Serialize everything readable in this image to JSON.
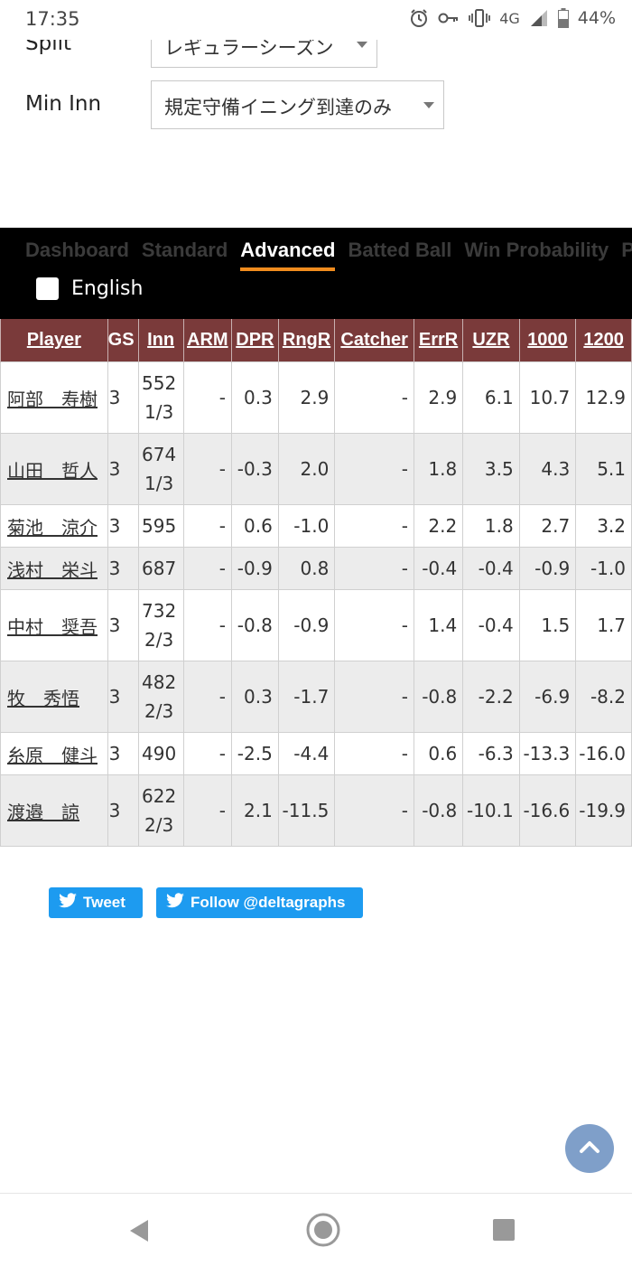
{
  "status_bar": {
    "time": "17:35",
    "network": "4G",
    "battery": "44%",
    "icons": [
      "alarm-icon",
      "key-icon",
      "vibrate-icon",
      "signal-icon",
      "battery-icon"
    ]
  },
  "filters": {
    "split_label": "Split",
    "split_value": "レギュラーシーズン",
    "min_inn_label": "Min Inn",
    "min_inn_value": "規定守備イニング到達のみ"
  },
  "tabs": [
    "Dashboard",
    "Standard",
    "Advanced",
    "Batted Ball",
    "Win Probability",
    "Pitch Type"
  ],
  "active_tab": "Advanced",
  "english_label": "English",
  "table": {
    "columns": [
      "Player",
      "GS",
      "Inn",
      "ARM",
      "DPR",
      "RngR",
      "Catcher",
      "ErrR",
      "UZR",
      "1000",
      "1200"
    ],
    "rows": [
      {
        "player": "阿部　寿樹",
        "gs": "3",
        "inn": "552\n1/3",
        "arm": "-",
        "dpr": "0.3",
        "rngr": "2.9",
        "catcher": "-",
        "errr": "2.9",
        "uzr": "6.1",
        "c1000": "10.7",
        "c1200": "12.9"
      },
      {
        "player": "山田　哲人",
        "gs": "3",
        "inn": "674\n1/3",
        "arm": "-",
        "dpr": "-0.3",
        "rngr": "2.0",
        "catcher": "-",
        "errr": "1.8",
        "uzr": "3.5",
        "c1000": "4.3",
        "c1200": "5.1"
      },
      {
        "player": "菊池　涼介",
        "gs": "3",
        "inn": "595",
        "arm": "-",
        "dpr": "0.6",
        "rngr": "-1.0",
        "catcher": "-",
        "errr": "2.2",
        "uzr": "1.8",
        "c1000": "2.7",
        "c1200": "3.2"
      },
      {
        "player": "浅村　栄斗",
        "gs": "3",
        "inn": "687",
        "arm": "-",
        "dpr": "-0.9",
        "rngr": "0.8",
        "catcher": "-",
        "errr": "-0.4",
        "uzr": "-0.4",
        "c1000": "-0.9",
        "c1200": "-1.0"
      },
      {
        "player": "中村　奨吾",
        "gs": "3",
        "inn": "732\n2/3",
        "arm": "-",
        "dpr": "-0.8",
        "rngr": "-0.9",
        "catcher": "-",
        "errr": "1.4",
        "uzr": "-0.4",
        "c1000": "1.5",
        "c1200": "1.7"
      },
      {
        "player": "牧　秀悟",
        "gs": "3",
        "inn": "482\n2/3",
        "arm": "-",
        "dpr": "0.3",
        "rngr": "-1.7",
        "catcher": "-",
        "errr": "-0.8",
        "uzr": "-2.2",
        "c1000": "-6.9",
        "c1200": "-8.2"
      },
      {
        "player": "糸原　健斗",
        "gs": "3",
        "inn": "490",
        "arm": "-",
        "dpr": "-2.5",
        "rngr": "-4.4",
        "catcher": "-",
        "errr": "0.6",
        "uzr": "-6.3",
        "c1000": "-13.3",
        "c1200": "-16.0"
      },
      {
        "player": "渡邉　諒",
        "gs": "3",
        "inn": "622\n2/3",
        "arm": "-",
        "dpr": "2.1",
        "rngr": "-11.5",
        "catcher": "-",
        "errr": "-0.8",
        "uzr": "-10.1",
        "c1000": "-16.6",
        "c1200": "-19.9"
      }
    ]
  },
  "share": {
    "tweet_label": "Tweet",
    "follow_label": "Follow @deltagraphs"
  },
  "colors": {
    "header_bg": "#7a3a3a",
    "tab_active_underline": "#f08c1e",
    "twitter_blue": "#1d9bf0",
    "scroll_top_bg": "#7f9fc9"
  }
}
